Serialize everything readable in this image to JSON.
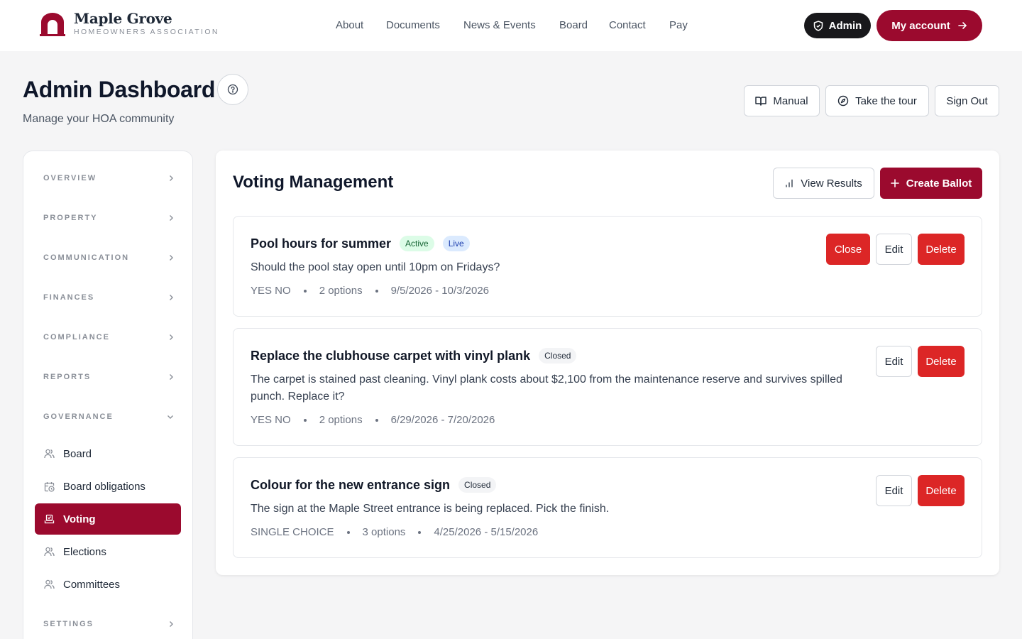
{
  "brand": {
    "name": "Maple Grove",
    "tagline": "HOMEOWNERS ASSOCIATION",
    "color": "#9b0a2e"
  },
  "nav": {
    "links": [
      "About",
      "Documents",
      "News & Events",
      "Board",
      "Contact",
      "Pay"
    ],
    "admin_label": "Admin",
    "account_label": "My account"
  },
  "header": {
    "title": "Admin Dashboard",
    "subtitle": "Manage your HOA community",
    "manual_label": "Manual",
    "tour_label": "Take the tour",
    "signout_label": "Sign Out"
  },
  "sidebar": {
    "sections": [
      "OVERVIEW",
      "PROPERTY",
      "COMMUNICATION",
      "FINANCES",
      "COMPLIANCE",
      "REPORTS",
      "GOVERNANCE"
    ],
    "governance_items": [
      {
        "label": "Board",
        "icon": "users-icon"
      },
      {
        "label": "Board obligations",
        "icon": "calendar-clock-icon"
      },
      {
        "label": "Voting",
        "icon": "ballot-box-icon",
        "active": true
      },
      {
        "label": "Elections",
        "icon": "users-icon"
      },
      {
        "label": "Committees",
        "icon": "users-icon"
      }
    ],
    "settings_label": "SETTINGS"
  },
  "main": {
    "title": "Voting Management",
    "view_results_label": "View Results",
    "create_ballot_label": "Create Ballot",
    "ballots": [
      {
        "title": "Pool hours for summer",
        "status": "Active",
        "live_badge": "Live",
        "description": "Should the pool stay open until 10pm on Fridays?",
        "type": "YES NO",
        "options": "2 options",
        "dates": "9/5/2026 - 10/3/2026",
        "close_label": "Close",
        "edit_label": "Edit",
        "delete_label": "Delete"
      },
      {
        "title": "Replace the clubhouse carpet with vinyl plank",
        "status": "Closed",
        "description": "The carpet is stained past cleaning. Vinyl plank costs about $2,100 from the maintenance reserve and survives spilled punch. Replace it?",
        "type": "YES NO",
        "options": "2 options",
        "dates": "6/29/2026 - 7/20/2026",
        "edit_label": "Edit",
        "delete_label": "Delete"
      },
      {
        "title": "Colour for the new entrance sign",
        "status": "Closed",
        "description": "The sign at the Maple Street entrance is being replaced. Pick the finish.",
        "type": "SINGLE CHOICE",
        "options": "3 options",
        "dates": "4/25/2026 - 5/15/2026",
        "edit_label": "Edit",
        "delete_label": "Delete"
      }
    ]
  }
}
